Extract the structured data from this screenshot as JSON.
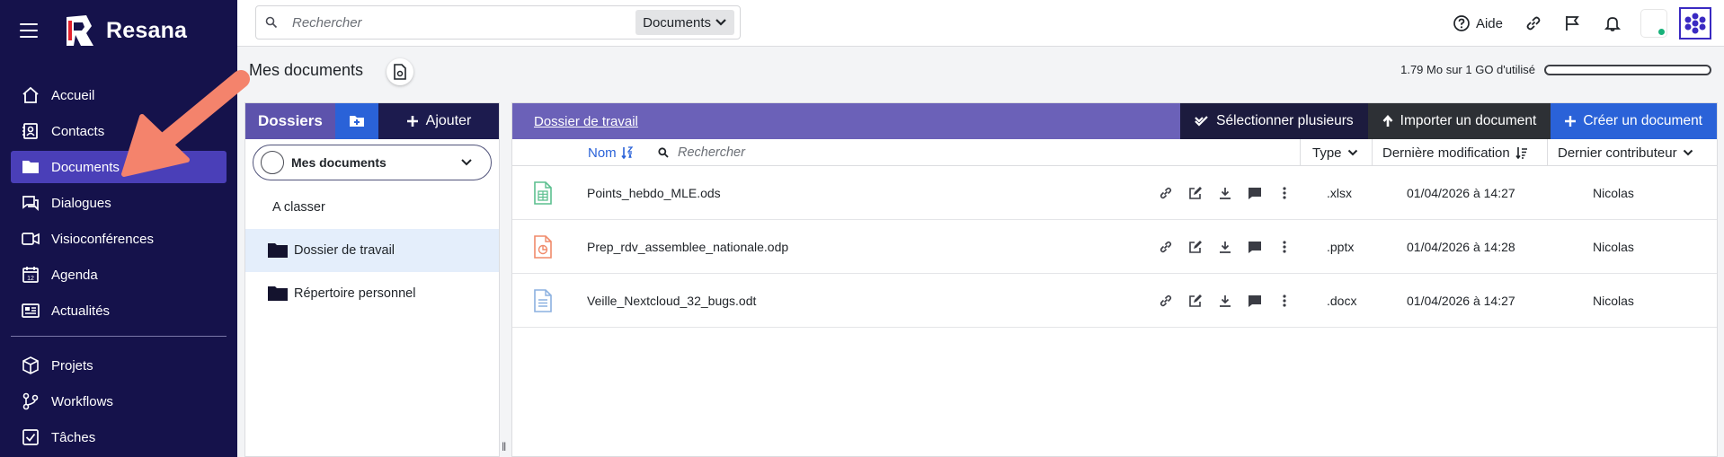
{
  "app": {
    "name": "Resana"
  },
  "sidebar": {
    "items": [
      {
        "label": "Accueil",
        "icon": "home-icon"
      },
      {
        "label": "Contacts",
        "icon": "contacts-icon"
      },
      {
        "label": "Documents",
        "icon": "folder-icon",
        "active": true
      },
      {
        "label": "Dialogues",
        "icon": "chat-icon"
      },
      {
        "label": "Visioconférences",
        "icon": "video-icon"
      },
      {
        "label": "Agenda",
        "icon": "calendar-icon"
      },
      {
        "label": "Actualités",
        "icon": "news-icon"
      }
    ],
    "items2": [
      {
        "label": "Projets",
        "icon": "cube-icon"
      },
      {
        "label": "Workflows",
        "icon": "workflow-icon"
      },
      {
        "label": "Tâches",
        "icon": "checkbox-icon"
      }
    ]
  },
  "topbar": {
    "search_placeholder": "Rechercher",
    "search_scope": "Documents",
    "help_label": "Aide"
  },
  "page": {
    "title": "Mes documents",
    "quota_text": "1.79 Mo sur 1 GO d'utilisé",
    "quota_used_fraction": 0.0017
  },
  "folders": {
    "title": "Dossiers",
    "add_label": "Ajouter",
    "selected_space": "Mes documents",
    "items": [
      {
        "label": "A classer",
        "icon": ""
      },
      {
        "label": "Dossier de travail",
        "icon": "folder-icon",
        "active": true
      },
      {
        "label": "Répertoire personnel",
        "icon": "folder-icon"
      }
    ]
  },
  "documents": {
    "breadcrumb": "Dossier de travail",
    "select_multiple_label": "Sélectionner plusieurs",
    "import_label": "Importer un document",
    "create_label": "Créer un document",
    "columns": {
      "name": "Nom",
      "search_placeholder": "Rechercher",
      "type": "Type",
      "modified": "Dernière modification",
      "contributor": "Dernier contributeur"
    },
    "rows": [
      {
        "name": "Points_hebdo_MLE.ods",
        "type": ".xlsx",
        "modified": "01/04/2026 à 14:27",
        "contributor": "Nicolas",
        "icon": "spreadsheet-icon",
        "color": "#5cbf8f"
      },
      {
        "name": "Prep_rdv_assemblee_nationale.odp",
        "type": ".pptx",
        "modified": "01/04/2026 à 14:28",
        "contributor": "Nicolas",
        "icon": "presentation-icon",
        "color": "#f08a6a"
      },
      {
        "name": "Veille_Nextcloud_32_bugs.odt",
        "type": ".docx",
        "modified": "01/04/2026 à 14:27",
        "contributor": "Nicolas",
        "icon": "text-document-icon",
        "color": "#8cb1e0"
      }
    ]
  },
  "colors": {
    "sidebar_bg": "#15124b",
    "sidebar_active": "#4a3fb8",
    "primary_blue": "#2a62d8",
    "header_purple": "#6b61b8",
    "arrow": "#f4836c"
  }
}
